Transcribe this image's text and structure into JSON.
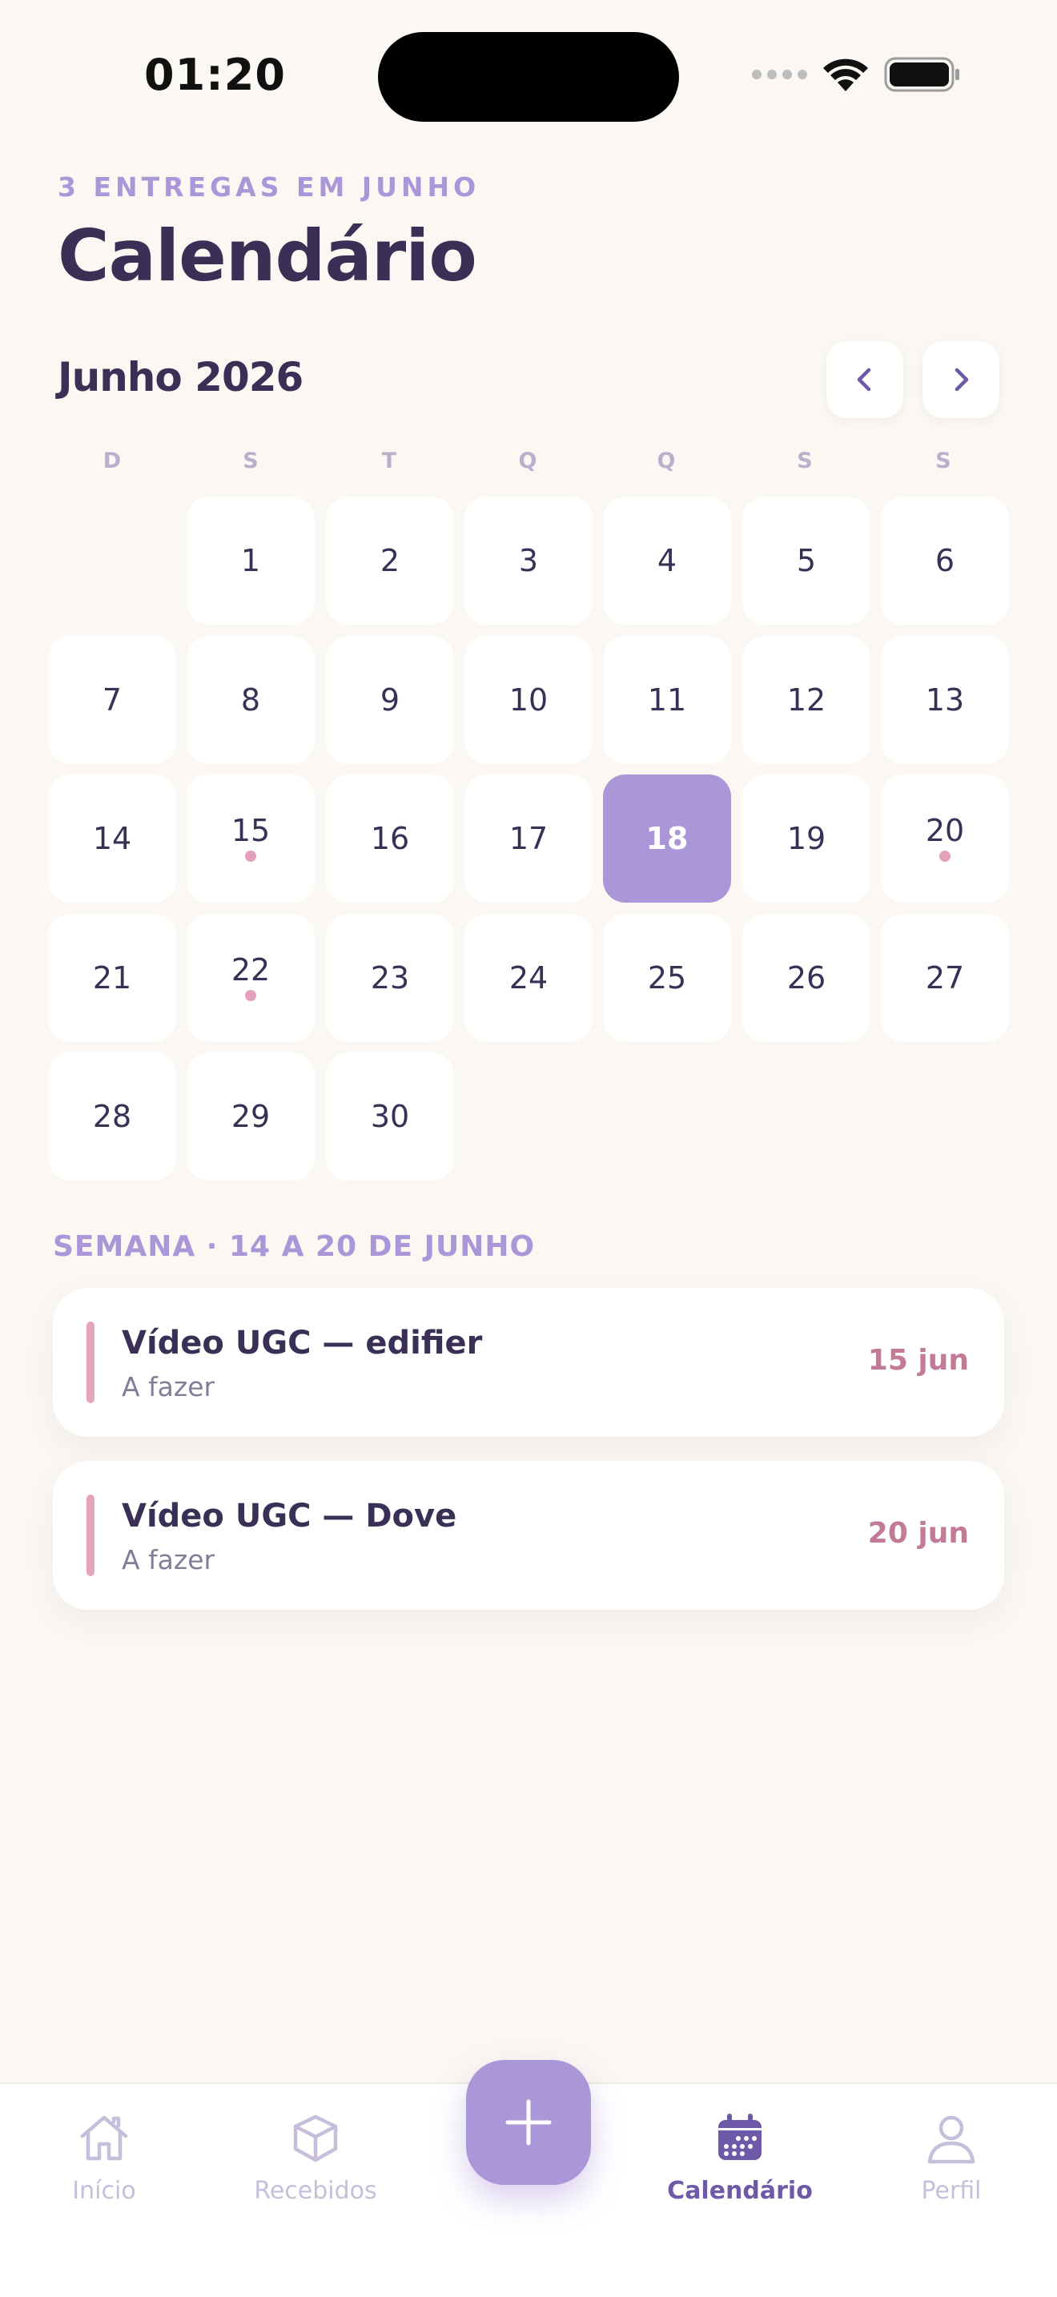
{
  "status_bar": {
    "time": "01:20"
  },
  "header": {
    "eyebrow": "3 ENTREGAS EM JUNHO",
    "title": "Calendário"
  },
  "calendar": {
    "month_label": "Junho 2026",
    "weekdays": [
      "D",
      "S",
      "T",
      "Q",
      "Q",
      "S",
      "S"
    ],
    "selected_day": 18,
    "days_with_tasks": [
      15,
      20,
      22
    ]
  },
  "week": {
    "label": "SEMANA · 14 A 20 DE JUNHO",
    "tasks": [
      {
        "title": "Vídeo UGC — edifier",
        "status": "A fazer",
        "date": "15 jun"
      },
      {
        "title": "Vídeo UGC — Dove",
        "status": "A fazer",
        "date": "20 jun"
      }
    ]
  },
  "tabbar": {
    "items": [
      {
        "label": "Início",
        "icon": "home-icon"
      },
      {
        "label": "Recebidos",
        "icon": "box-icon"
      },
      {
        "label": "Calendário",
        "icon": "calendar-icon",
        "active": true
      },
      {
        "label": "Perfil",
        "icon": "user-icon"
      }
    ],
    "fab_icon": "plus-icon"
  },
  "colors": {
    "accent": "#ab96d8",
    "accent_dark": "#6e59a8",
    "task_marker": "#e5a4be",
    "date_text": "#c27a98",
    "background": "#fbf8f3"
  }
}
